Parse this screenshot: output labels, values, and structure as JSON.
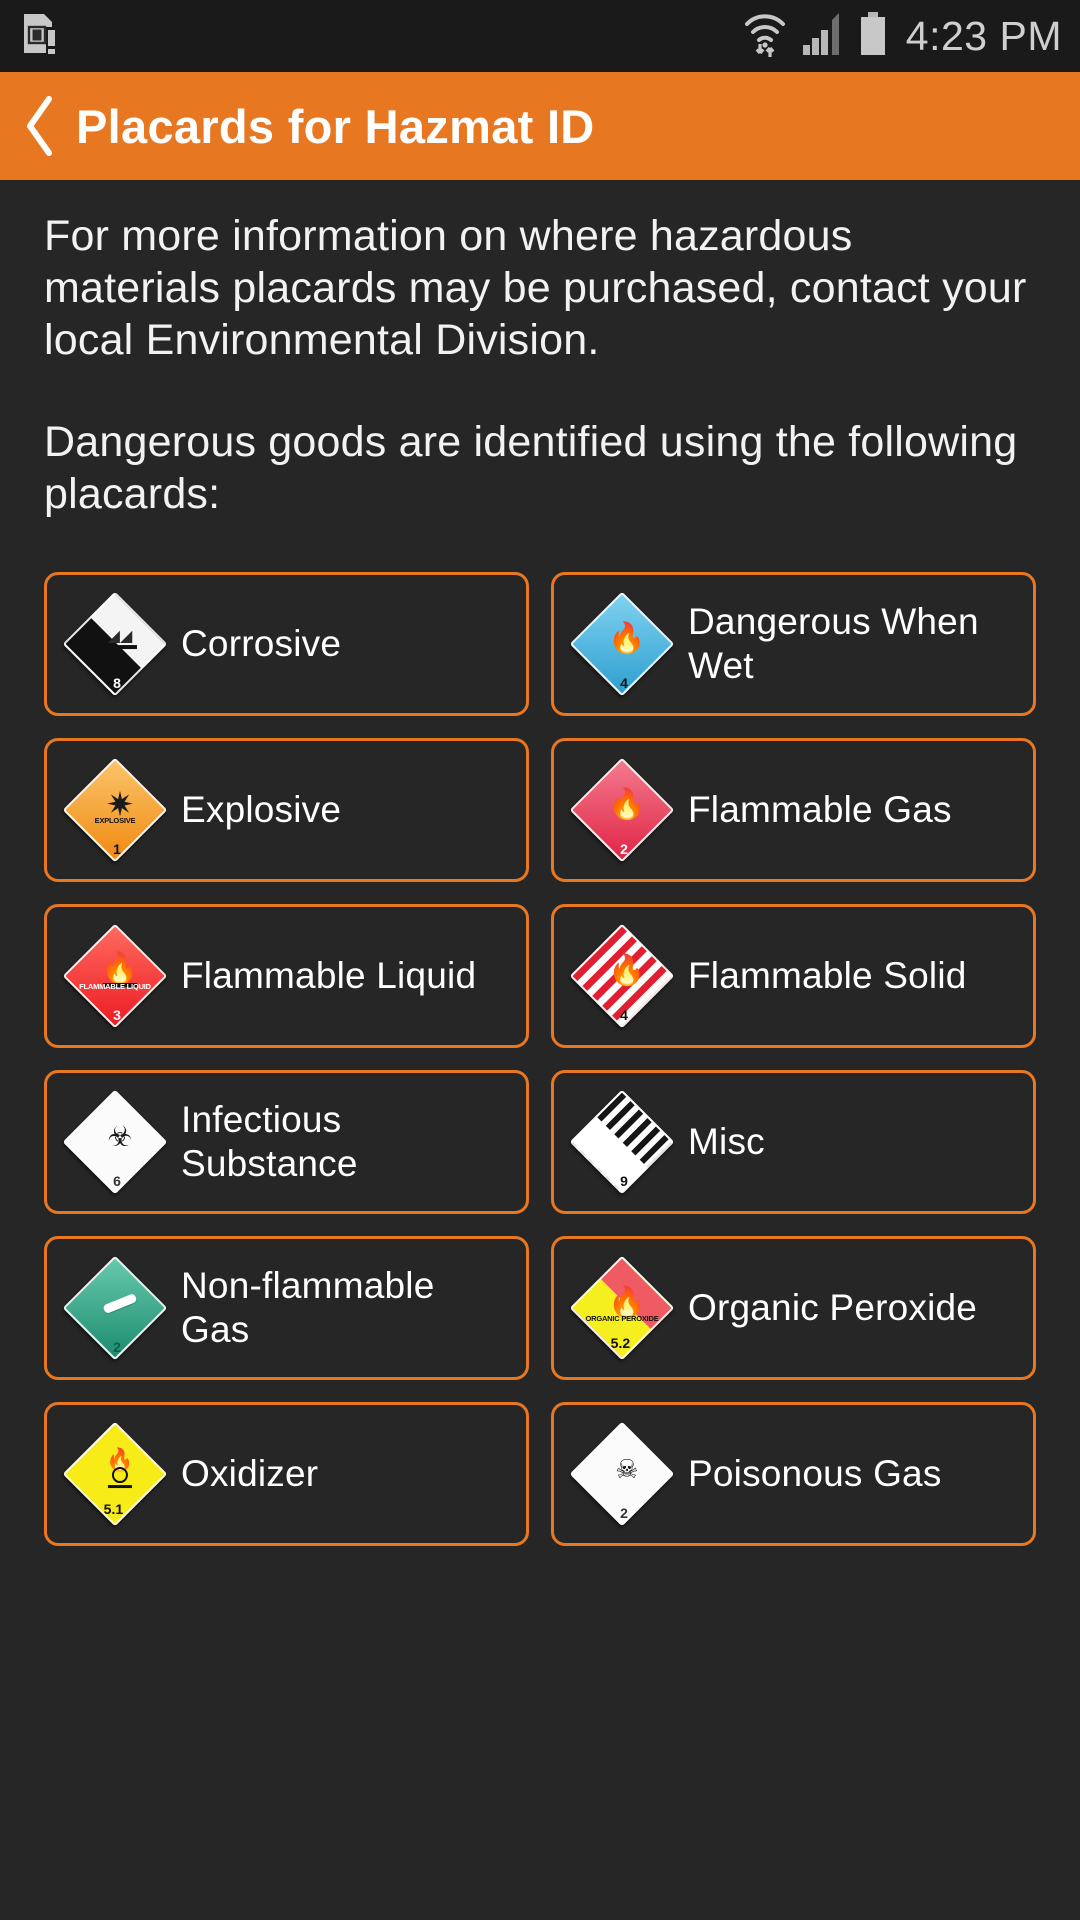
{
  "statusbar": {
    "time": "4:23 PM",
    "icons": [
      "sim-card-alert-icon",
      "wifi-icon",
      "cellular-signal-icon",
      "battery-icon"
    ]
  },
  "actionbar": {
    "back_label": "❮",
    "title": "Placards for Hazmat ID",
    "bg_color": "#e87722"
  },
  "content": {
    "paragraph_1": "For more information on where hazardous materials placards may be purchased, contact your local Environmental Division.",
    "paragraph_2": "Dangerous goods are identified using the following placards:"
  },
  "placards": [
    {
      "label": "Corrosive",
      "class_number": "8",
      "placard_text": "",
      "fill": "f-corrosive"
    },
    {
      "label": "Dangerous When Wet",
      "class_number": "4",
      "placard_text": "",
      "fill": "f-dangerwet"
    },
    {
      "label": "Explosive",
      "class_number": "1",
      "placard_text": "EXPLOSIVE",
      "fill": "f-explosive"
    },
    {
      "label": "Flammable Gas",
      "class_number": "2",
      "placard_text": "",
      "fill": "f-flamgas"
    },
    {
      "label": "Flammable Liquid",
      "class_number": "3",
      "placard_text": "FLAMMABLE LIQUID",
      "fill": "f-flamliq"
    },
    {
      "label": "Flammable Solid",
      "class_number": "4",
      "placard_text": "",
      "fill": "f-flamsolid"
    },
    {
      "label": "Infectious Substance",
      "class_number": "6",
      "placard_text": "",
      "fill": "f-infect"
    },
    {
      "label": "Misc",
      "class_number": "9",
      "placard_text": "",
      "fill": "f-misc"
    },
    {
      "label": "Non-flammable Gas",
      "class_number": "2",
      "placard_text": "",
      "fill": "f-nonflam"
    },
    {
      "label": "Organic Peroxide",
      "class_number": "5.2",
      "placard_text": "ORGANIC PEROXIDE",
      "fill": "f-orgperox"
    },
    {
      "label": "Oxidizer",
      "class_number": "5.1",
      "placard_text": "",
      "fill": "f-oxidizer"
    },
    {
      "label": "Poisonous Gas",
      "class_number": "2",
      "placard_text": "",
      "fill": "f-poison"
    }
  ]
}
